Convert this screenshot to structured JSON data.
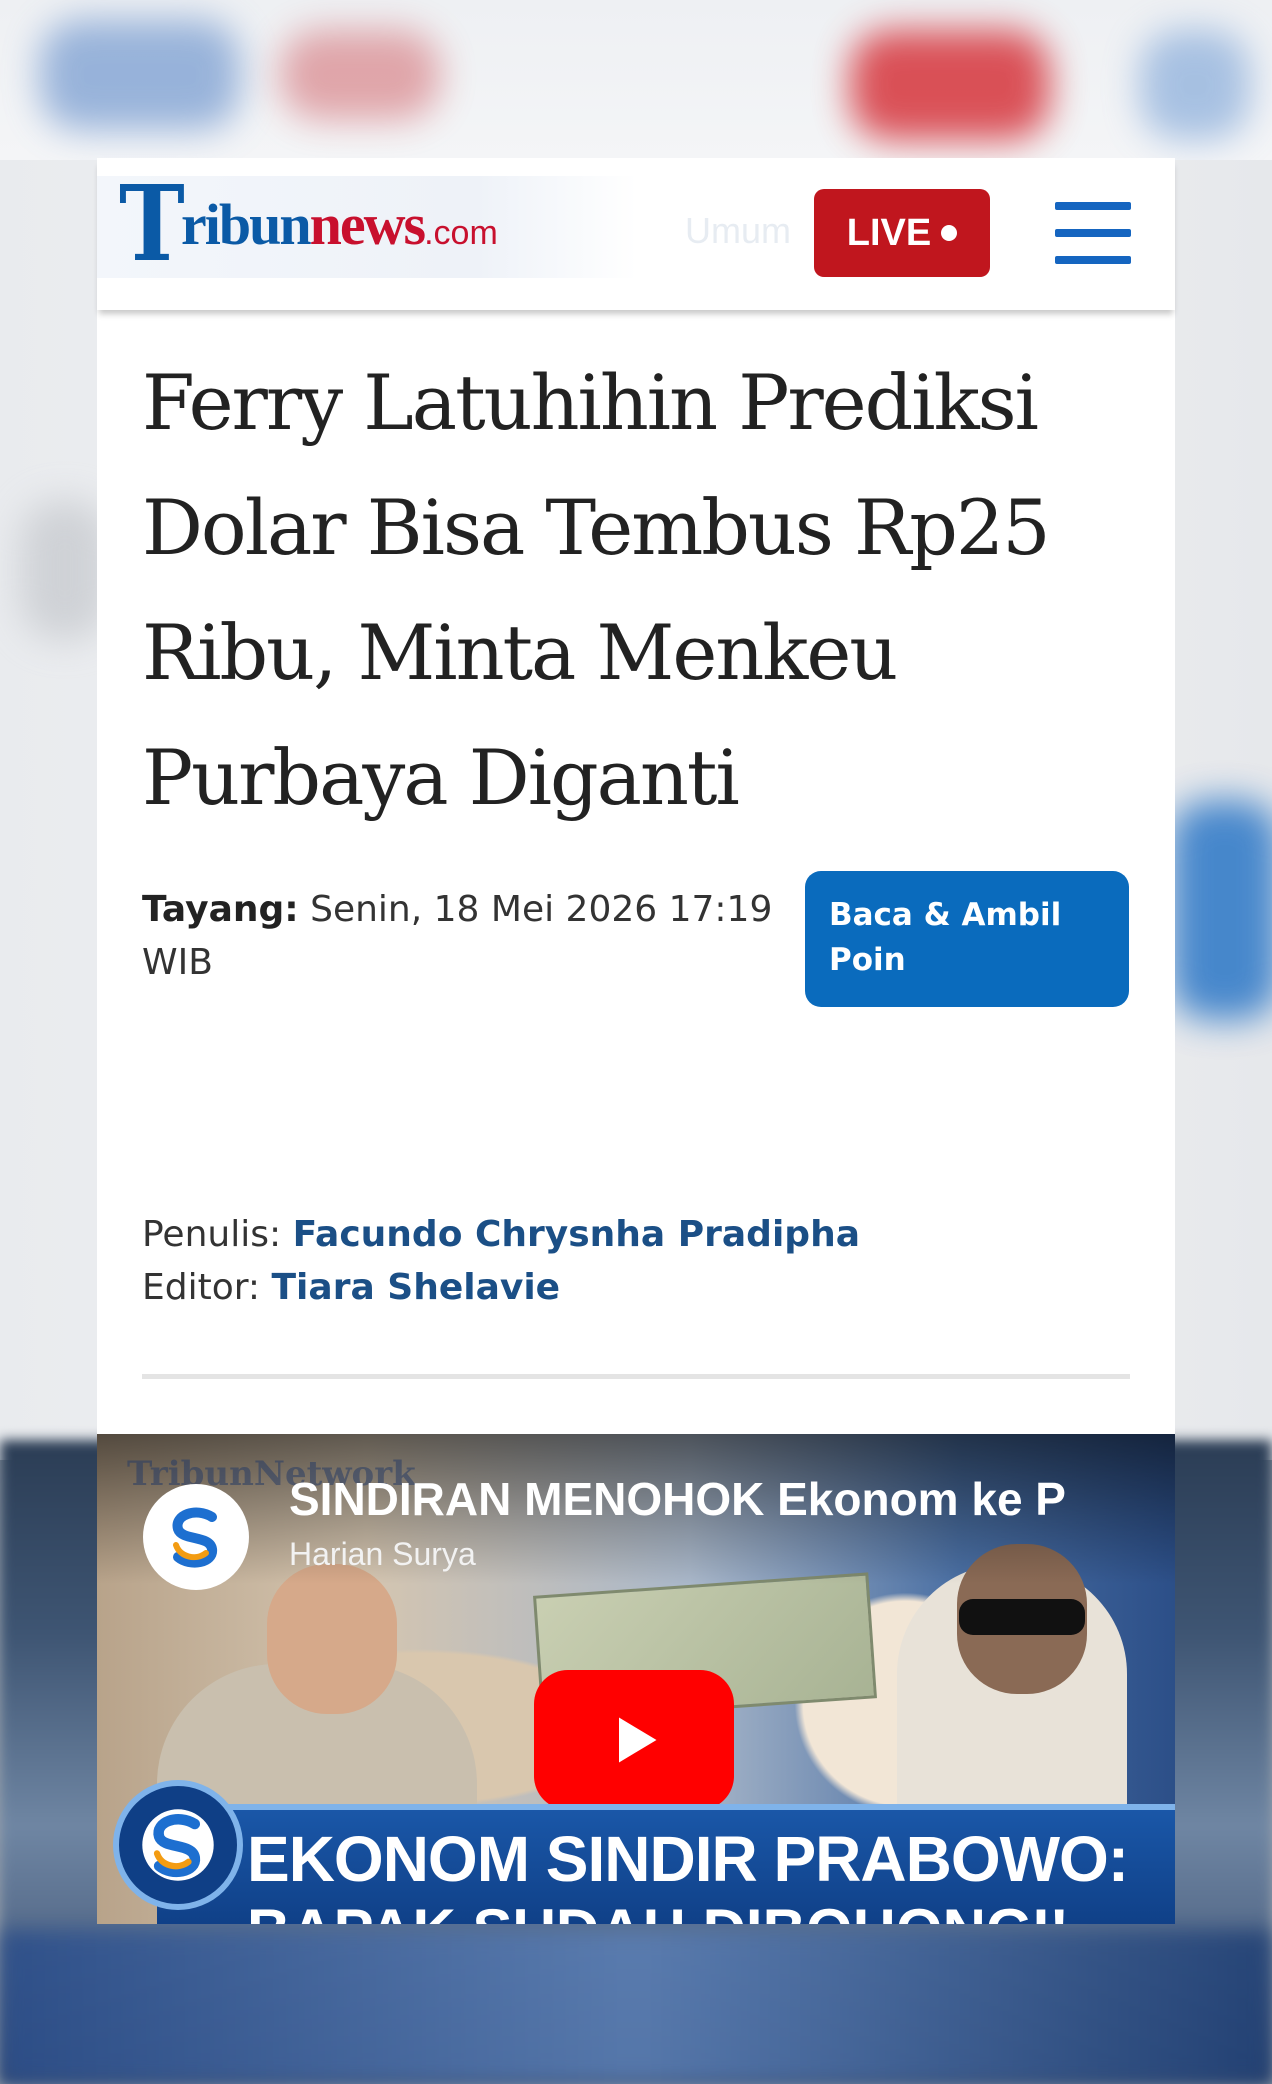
{
  "site": {
    "logo_initial": "T",
    "logo_word": "ribun",
    "logo_news": "news",
    "logo_suffix": ".com",
    "nav_hint": "Umum",
    "live_label": "LIVE",
    "brand_blue": "#0b5aa6",
    "brand_red": "#c0161e"
  },
  "article": {
    "title": "Ferry Latuhihin Prediksi Dolar Bisa Tembus Rp25 Ribu, Minta Menkeu Purbaya Diganti",
    "published_label": "Tayang:",
    "published_value": "Senin, 18 Mei 2026 17:19 WIB",
    "points_button": "Baca & Ambil Poin",
    "writer_label": "Penulis:",
    "writer_name": "Facundo Chrysnha Pradipha",
    "editor_label": "Editor:",
    "editor_name": "Tiara Shelavie"
  },
  "share": {
    "icons": [
      "x-icon",
      "facebook-icon",
      "whatsapp-icon",
      "telegram-icon",
      "comment-icon"
    ]
  },
  "video": {
    "watermark": "TribunNetwork",
    "title": "SINDIRAN MENOHOK Ekonom ke P",
    "channel": "Harian Surya",
    "banner_text": "EKONOM SINDIR PRABOWO:",
    "banner_sub": "BAPAK SUDAH DIBOHONGI!"
  }
}
